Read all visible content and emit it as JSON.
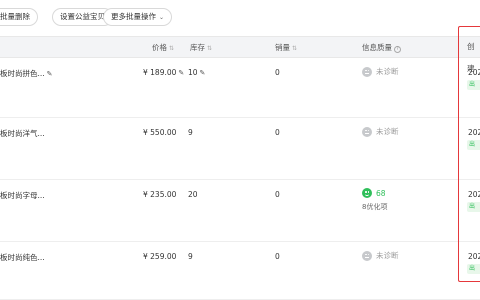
{
  "toolbar": {
    "btn_batch_delete": "批量删除",
    "btn_set_public": "设置公益宝贝",
    "btn_more": "更多批量操作",
    "chevron": "⌄"
  },
  "columns": {
    "price": "价格",
    "stock": "库存",
    "sales": "销量",
    "quality": "信息质量",
    "created": "创建"
  },
  "rows": [
    {
      "title": "板时尚拼色...",
      "price": "¥ 189.00",
      "stock": "10",
      "sales": "0",
      "quality": "未诊断",
      "date": "202",
      "badge": "出售"
    },
    {
      "title": "板时尚洋气...",
      "price": "¥ 550.00",
      "stock": "9",
      "sales": "0",
      "quality": "未诊断",
      "date": "202",
      "badge": "出售"
    },
    {
      "title": "板时尚字母...",
      "price": "¥ 235.00",
      "stock": "20",
      "sales": "0",
      "quality_score": "68",
      "quality_note": "8优化项",
      "date": "202",
      "badge": "出售"
    },
    {
      "title": "板时尚纯色...",
      "price": "¥ 259.00",
      "stock": "9",
      "sales": "0",
      "quality": "未诊断",
      "date": "202",
      "badge": "出售"
    }
  ],
  "colors": {
    "accent_green": "#2fbf5a",
    "highlight_red": "#e5383b"
  },
  "icons": {
    "edit": "pencil-icon",
    "sort": "sort-icon",
    "help": "question-icon",
    "face": "face-icon"
  }
}
